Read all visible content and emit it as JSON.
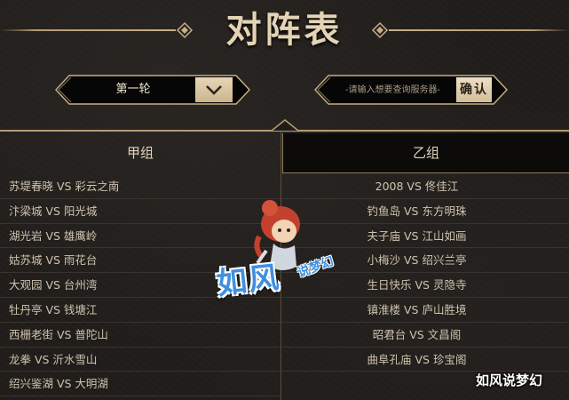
{
  "header": {
    "title": "对阵表"
  },
  "controls": {
    "round_select": {
      "value": "第一轮"
    },
    "server_search": {
      "placeholder": "-请输入想要查询服务器-"
    },
    "confirm_label": "确认"
  },
  "groups": {
    "a": {
      "label": "甲组",
      "matches": [
        "苏堤春晓 VS 彩云之南",
        "汴梁城 VS 阳光城",
        "湖光岩 VS 雄鹰岭",
        "姑苏城 VS 雨花台",
        "大观园 VS 台州湾",
        "牡丹亭 VS 钱塘江",
        "西栅老街 VS 普陀山",
        "龙拳 VS 沂水雪山",
        "绍兴鉴湖 VS 大明湖"
      ]
    },
    "b": {
      "label": "乙组",
      "matches": [
        "2008 VS 佟佳江",
        "钓鱼岛 VS 东方明珠",
        "夫子庙 VS 江山如画",
        "小梅沙 VS 绍兴兰亭",
        "生日快乐 VS 灵隐寺",
        "镇淮楼 VS 庐山胜境",
        "昭君台 VS 文昌阁",
        "曲阜孔庙 VS 珍宝阁"
      ]
    }
  },
  "watermark": {
    "mascot_text_big": "如风",
    "mascot_text_small": "说梦幻",
    "corner_text": "如风说梦幻"
  },
  "colors": {
    "background": "#1f1c1a",
    "accent_gold": "#c7ae86",
    "text": "#cfc3ae",
    "watermark_blue": "#3f8fe0"
  }
}
